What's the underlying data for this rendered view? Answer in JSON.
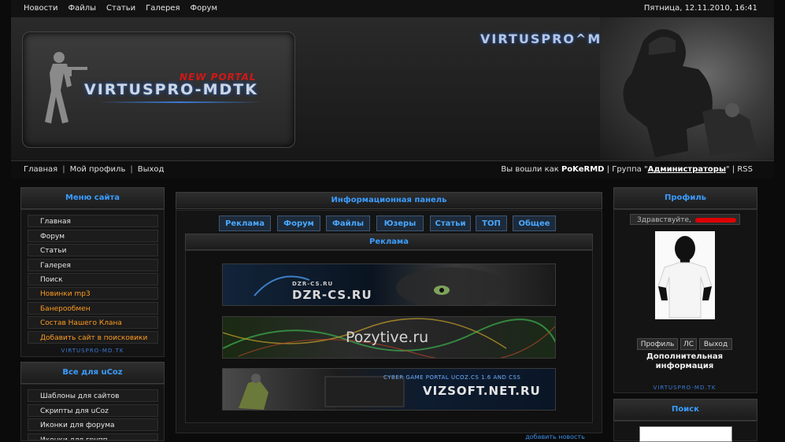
{
  "topnav": [
    "Новости",
    "Файлы",
    "Статьи",
    "Галерея",
    "Форум"
  ],
  "datetime": "Пятница, 12.11.2010, 16:41",
  "header": {
    "new_portal": "NEW PORTAL",
    "logo_title": "VIRTUSPRO-MDTK",
    "brand_right": "VIRTUSPRO^MD"
  },
  "subnav": {
    "left": [
      "Главная",
      "Мой профиль",
      "Выход"
    ],
    "logged_prefix": "Вы вошли как",
    "username": "PoKeRMD",
    "group_prefix": "| Группа \"",
    "group_name": "Администраторы",
    "group_suffix": "\" |",
    "rss": "RSS"
  },
  "left_menu": {
    "title": "Меню сайта",
    "items": [
      {
        "label": "Главная"
      },
      {
        "label": "Форум"
      },
      {
        "label": "Статьи"
      },
      {
        "label": "Галерея"
      },
      {
        "label": "Поиск"
      },
      {
        "label": "Новинки mp3"
      },
      {
        "label": "Банерообмен"
      },
      {
        "label": "Состав Нашего Клана"
      },
      {
        "label": "Добавить сайт в поисковики"
      }
    ],
    "footer": "VIRTUSPRO-MD.TK"
  },
  "left_menu2": {
    "title": "Все для uCoz",
    "items": [
      {
        "label": "Шаблоны для сайтов"
      },
      {
        "label": "Скрипты для uCoz"
      },
      {
        "label": "Иконки для форума"
      },
      {
        "label": "Иконки для групп"
      }
    ]
  },
  "center": {
    "panel_title": "Информационная панель",
    "tabs": [
      "Реклама",
      "Форум",
      "Файлы",
      "Юзеры",
      "Статьи",
      "ТОП",
      "Общее"
    ],
    "active_section": "Реклама",
    "banners": [
      {
        "small": "DZR-CS.RU",
        "big": "DZR-CS.RU"
      },
      {
        "big": "Pozytive.ru"
      },
      {
        "small": "CYBER GAME PORTAL   UCOZ.CS 1.6 AND CSS",
        "big": "VIZSOFT.NET.RU"
      }
    ],
    "add_news": "добавить новость"
  },
  "right": {
    "profile_title": "Профиль",
    "greeting": "Здравствуйте,",
    "buttons": [
      "Профиль",
      "ЛС",
      "Выход"
    ],
    "extra_line1": "Дополнительная",
    "extra_line2": "информация",
    "footer": "VIRTUSPRO-MD.TK",
    "search_title": "Поиск"
  },
  "colors": {
    "accent": "#3a9cff",
    "orange": "#ff9c1f",
    "red": "#d01818"
  }
}
